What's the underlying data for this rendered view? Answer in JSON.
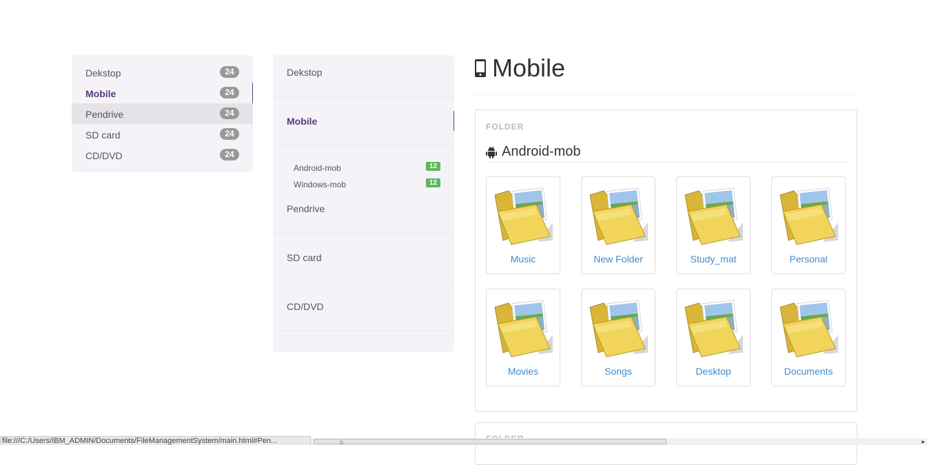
{
  "sidebar": {
    "items": [
      {
        "label": "Dekstop",
        "count": "24"
      },
      {
        "label": "Mobile",
        "count": "24"
      },
      {
        "label": "Pendrive",
        "count": "24"
      },
      {
        "label": "SD card",
        "count": "24"
      },
      {
        "label": "CD/DVD",
        "count": "24"
      }
    ]
  },
  "middle_nav": {
    "desktop": "Dekstop",
    "mobile": "Mobile",
    "subitems": [
      {
        "label": "Android-mob",
        "count": "12"
      },
      {
        "label": "Windows-mob",
        "count": "12"
      }
    ],
    "pendrive": "Pendrive",
    "sdcard": "SD card",
    "cddvd": "CD/DVD"
  },
  "main": {
    "title": "Mobile",
    "section_label": "FOLDER",
    "section_label_2": "FOLDER",
    "folder_heading": "Android-mob",
    "folders": [
      "Music",
      "New Folder",
      "Study_mat",
      "Personal",
      "Movies",
      "Songs",
      "Desktop",
      "Documents"
    ]
  },
  "status_bar": {
    "url": "file:///C:/Users/IBM_ADMIN/Documents/FileManagementSystem/main.html#Pen..."
  },
  "colors": {
    "accent": "#563d7c",
    "link": "#428bca",
    "badge_gray": "#999999",
    "badge_green": "#5cb85c",
    "nav_bg": "#f6f3f8"
  },
  "icons": {
    "title": "mobile-phone-icon",
    "heading": "android-icon",
    "folder": "folder-icon"
  }
}
